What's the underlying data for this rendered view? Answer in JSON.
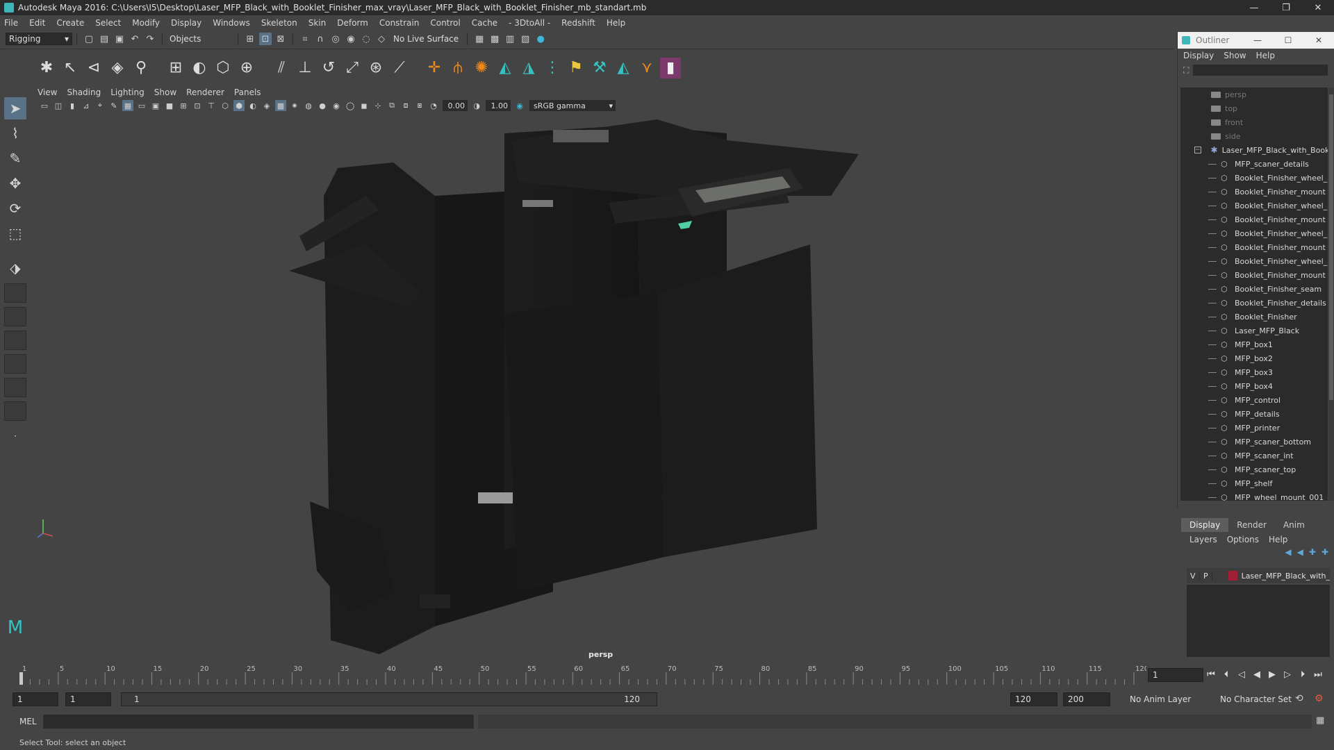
{
  "titlebar": {
    "title": "Autodesk Maya 2016: C:\\Users\\I5\\Desktop\\Laser_MFP_Black_with_Booklet_Finisher_max_vray\\Laser_MFP_Black_with_Booklet_Finisher_mb_standart.mb",
    "minimize": "—",
    "restore": "❐",
    "close": "✕"
  },
  "menubar": [
    "File",
    "Edit",
    "Create",
    "Select",
    "Modify",
    "Display",
    "Windows",
    "Skeleton",
    "Skin",
    "Deform",
    "Constrain",
    "Control",
    "Cache",
    "- 3DtoAll -",
    "Redshift",
    "Help"
  ],
  "statusline": {
    "menuset": "Rigging",
    "selection_mode": "Objects",
    "live_surface": "No Live Surface"
  },
  "viewport": {
    "menu": [
      "View",
      "Shading",
      "Lighting",
      "Show",
      "Renderer",
      "Panels"
    ],
    "exposure": "0.00",
    "gamma_value": "1.00",
    "color_space": "sRGB gamma",
    "camera_label": "persp"
  },
  "outliner": {
    "title": "Outliner",
    "menu": [
      "Display",
      "Show",
      "Help"
    ],
    "cameras": [
      "persp",
      "top",
      "front",
      "side"
    ],
    "group": "Laser_MFP_Black_with_Bookl",
    "items": [
      "MFP_scaner_details",
      "Booklet_Finisher_wheel_",
      "Booklet_Finisher_mount",
      "Booklet_Finisher_wheel_",
      "Booklet_Finisher_mount",
      "Booklet_Finisher_wheel_",
      "Booklet_Finisher_mount",
      "Booklet_Finisher_wheel_",
      "Booklet_Finisher_mount",
      "Booklet_Finisher_seam",
      "Booklet_Finisher_details",
      "Booklet_Finisher",
      "Laser_MFP_Black",
      "MFP_box1",
      "MFP_box2",
      "MFP_box3",
      "MFP_box4",
      "MFP_control",
      "MFP_details",
      "MFP_printer",
      "MFP_scaner_bottom",
      "MFP_scaner_int",
      "MFP_scaner_top",
      "MFP_shelf",
      "MFP_wheel_mount_001"
    ]
  },
  "layers": {
    "tabs": [
      "Display",
      "Render",
      "Anim"
    ],
    "menu": [
      "Layers",
      "Options",
      "Help"
    ],
    "row": {
      "v": "V",
      "p": "P",
      "name": "Laser_MFP_Black_with_"
    }
  },
  "timeline": {
    "ticks": [
      "1",
      "5",
      "10",
      "15",
      "20",
      "25",
      "30",
      "35",
      "40",
      "45",
      "50",
      "55",
      "60",
      "65",
      "70",
      "75",
      "80",
      "85",
      "90",
      "95",
      "100",
      "105",
      "110",
      "115",
      "120"
    ],
    "current_frame": "1"
  },
  "range": {
    "start": "1",
    "playback_start": "1",
    "slider_start": "1",
    "slider_end": "120",
    "playback_end": "120",
    "end": "200",
    "anim_layer": "No Anim Layer",
    "character_set": "No Character Set"
  },
  "cmdline": {
    "label": "MEL"
  },
  "helpline": {
    "text": "Select Tool: select an object"
  }
}
